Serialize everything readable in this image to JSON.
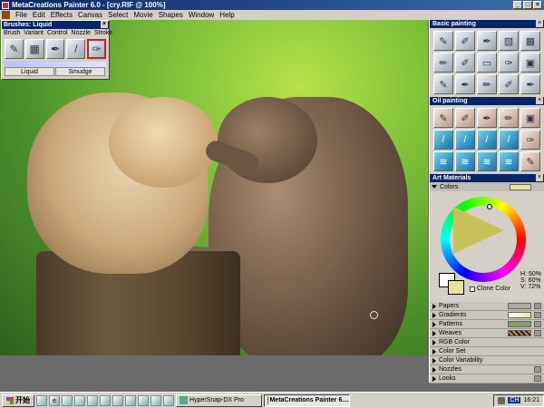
{
  "window": {
    "title": "MetaCreations Painter 6.0 - [cry.RIF @ 100%]"
  },
  "menu": [
    "File",
    "Edit",
    "Effects",
    "Canvas",
    "Select",
    "Movie",
    "Shapes",
    "Window",
    "Help"
  ],
  "brushes_palette": {
    "title": "Brushes: Liquid",
    "menu": [
      "Brush",
      "Variant",
      "Control",
      "Nozzle",
      "Stroke"
    ],
    "labels": [
      "Liquid",
      "Smudge"
    ]
  },
  "panels": {
    "basic_painting": "Basic painting",
    "oil_painting": "Oil painting",
    "art_materials": "Art Materials"
  },
  "colors": {
    "label": "Colors",
    "hsv": {
      "h": "H: 50%",
      "s": "S: 60%",
      "v": "V: 72%"
    },
    "clone_color": "Clone Color",
    "primary": "#ffffff",
    "secondary": "#e8e4a0"
  },
  "art_material_rows": [
    "Papers",
    "Gradients",
    "Patterns",
    "Weaves",
    "RGB Color",
    "Color Set",
    "Color Variability",
    "Nozzles",
    "Looks"
  ],
  "taskbar": {
    "start": "开始",
    "tasks": [
      "HyperSnap-DX Pro",
      "MetaCreations Painter 6...."
    ],
    "clock": "16:21",
    "ime": "CH"
  }
}
